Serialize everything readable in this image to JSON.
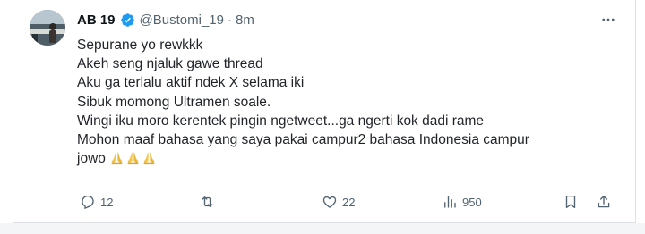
{
  "tweet": {
    "author": {
      "display_name": "AB 19",
      "handle": "@Bustomi_19",
      "separator": "·",
      "timestamp": "8m",
      "verified": true
    },
    "text_lines": [
      "Sepurane yo rewkkk",
      "Akeh seng njaluk gawe thread",
      "Aku ga terlalu aktif ndek X selama iki",
      "Sibuk momong Ultramen soale.",
      "Wingi iku moro kerentek pingin ngetweet...ga ngerti kok dadi rame",
      "Mohon maaf bahasa yang saya pakai campur2 bahasa Indonesia campur",
      "jowo"
    ],
    "emoji": "🙏🙏🙏",
    "actions": {
      "replies": "12",
      "reposts": "",
      "likes": "22",
      "views": "950"
    }
  },
  "colors": {
    "text": "#0f1419",
    "secondary": "#536471",
    "verified": "#1d9bf0",
    "border": "#dde1e4"
  },
  "icons": [
    "verified-badge-icon",
    "more-options-icon",
    "reply-icon",
    "repost-icon",
    "like-icon",
    "views-icon",
    "bookmark-icon",
    "share-icon"
  ]
}
